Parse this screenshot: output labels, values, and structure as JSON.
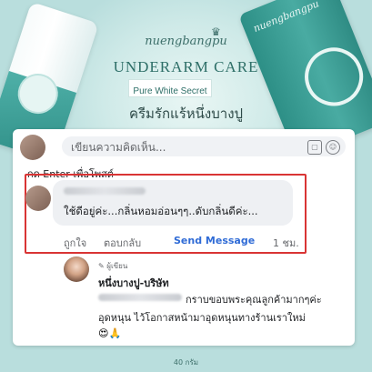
{
  "banner": {
    "brand": "nuengbangpu",
    "title": "UNDERARM CARE",
    "subtitle": "Pure White Secret",
    "tagline": "ครีมรักแร้หนึ่งบางปู",
    "footer_weight": "40 กรัม"
  },
  "composer": {
    "placeholder": "เขียนความคิดเห็น...",
    "hint": "กด Enter เพื่อโพสต์",
    "icons": [
      "sticker-icon",
      "emoji-icon"
    ]
  },
  "comment": {
    "text": "ใช้ดีอยู่ค่ะ...กลิ่นหอมอ่อนๆๆ..ดับกลิ่นดีค่ะ...",
    "actions": {
      "like": "ถูกใจ",
      "reply": "ตอบกลับ",
      "send_message": "Send Message",
      "time": "1 ชม."
    }
  },
  "reply": {
    "badge": "ผู้เขียน",
    "name": "หนึ่งบางปู-บริษัท",
    "line1": "กราบขอบพระคุณลูกค้ามากๆค่ะ",
    "line2": "อุดหนุน ไว้โอกาสหน้ามาอุดหนุนทางร้านเราใหม่",
    "emoji": "😍🙏"
  },
  "colors": {
    "background": "#b9dedd",
    "accent": "#2e6f68",
    "highlight": "#d93434",
    "link": "#2f6bd6"
  }
}
